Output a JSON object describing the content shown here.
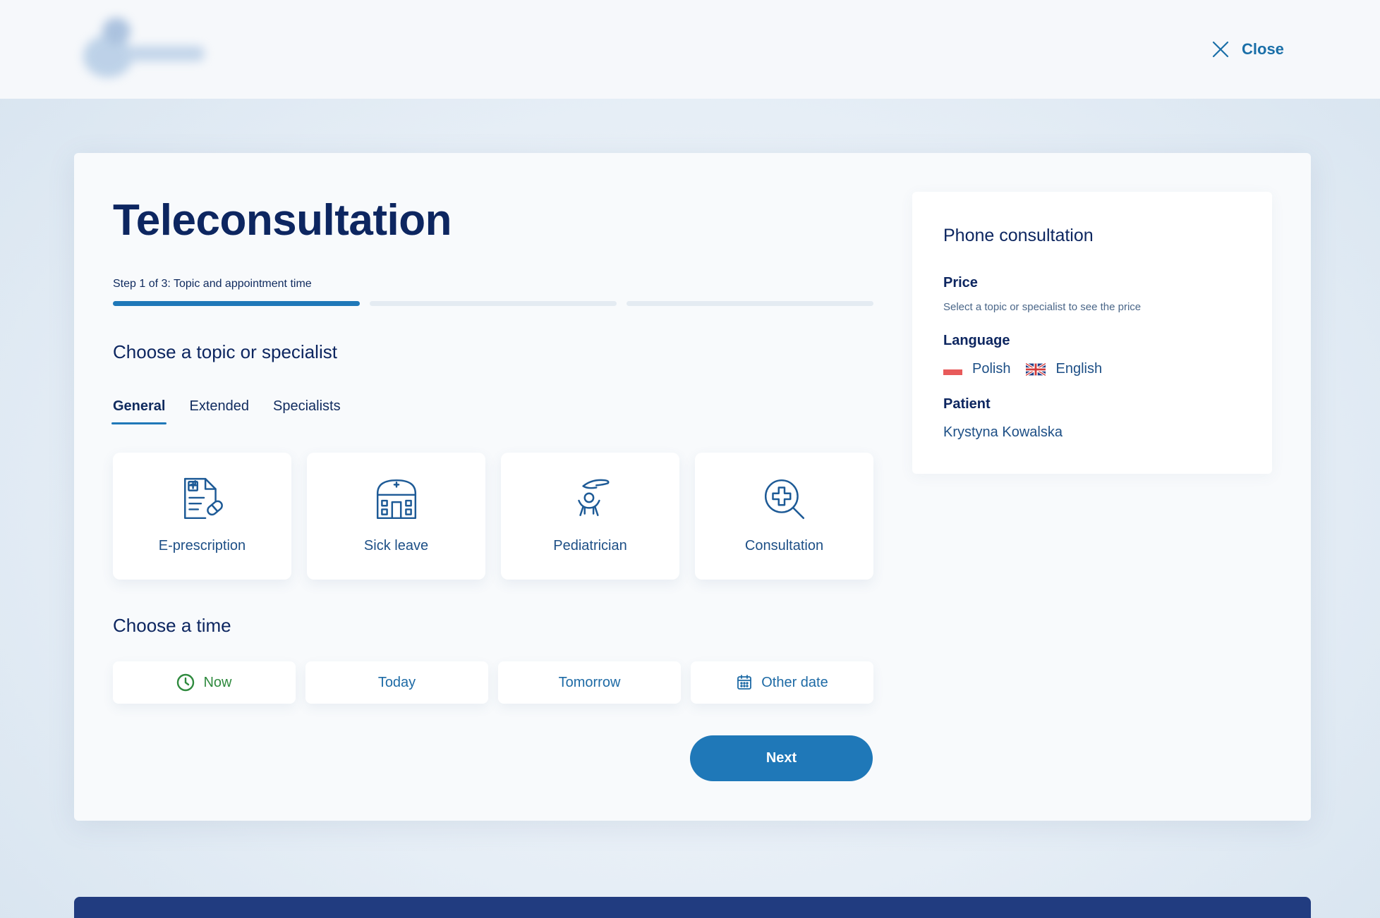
{
  "header": {
    "close_label": "Close"
  },
  "main": {
    "title": "Teleconsultation",
    "step_label": "Step 1 of 3: Topic and appointment time",
    "progress": {
      "current_step": 1,
      "total_steps": 3
    },
    "topic_heading": "Choose a topic or specialist",
    "tabs": [
      {
        "label": "General",
        "active": true
      },
      {
        "label": "Extended",
        "active": false
      },
      {
        "label": "Specialists",
        "active": false
      }
    ],
    "topics": [
      {
        "label": "E-prescription",
        "icon": "e-prescription-icon"
      },
      {
        "label": "Sick leave",
        "icon": "sick-leave-icon"
      },
      {
        "label": "Pediatrician",
        "icon": "pediatrician-icon"
      },
      {
        "label": "Consultation",
        "icon": "consultation-icon"
      }
    ],
    "time_heading": "Choose a time",
    "times": [
      {
        "label": "Now",
        "icon": "clock-icon",
        "selected": true
      },
      {
        "label": "Today",
        "selected": false
      },
      {
        "label": "Tomorrow",
        "selected": false
      },
      {
        "label": "Other date",
        "icon": "calendar-icon",
        "selected": false
      }
    ],
    "next_label": "Next"
  },
  "summary": {
    "title": "Phone consultation",
    "price_label": "Price",
    "price_note": "Select a topic or specialist to see the price",
    "language_label": "Language",
    "languages": [
      {
        "label": "Polish",
        "icon": "poland-flag-icon"
      },
      {
        "label": "English",
        "icon": "uk-flag-icon"
      }
    ],
    "patient_label": "Patient",
    "patient_name": "Krystyna Kowalska"
  },
  "colors": {
    "accent": "#1f78b8",
    "title": "#0d2660",
    "selected_time": "#2f8a3e",
    "footer": "#213c80"
  }
}
